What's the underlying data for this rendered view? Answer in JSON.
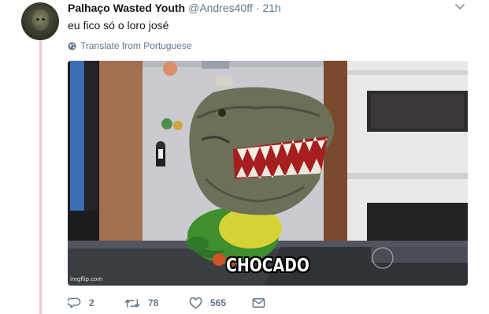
{
  "tweet": {
    "display_name": "Palhaço Wasted Youth",
    "handle": "@Andres40ff",
    "separator": "·",
    "time": "21h",
    "text": "eu fico só o loro josé",
    "translate_label": "Translate from Portuguese"
  },
  "media": {
    "caption": "CHOCADO",
    "watermark": "imgflip.com"
  },
  "actions": {
    "reply_count": "2",
    "retweet_count": "78",
    "like_count": "565"
  },
  "icons": {
    "more": "chevron-down-icon",
    "translate": "globe-icon",
    "reply": "reply-icon",
    "retweet": "retweet-icon",
    "like": "heart-icon",
    "message": "envelope-icon"
  },
  "colors": {
    "thread_line": "#f4c2d1",
    "secondary_text": "#657786",
    "primary_text": "#14171a"
  }
}
